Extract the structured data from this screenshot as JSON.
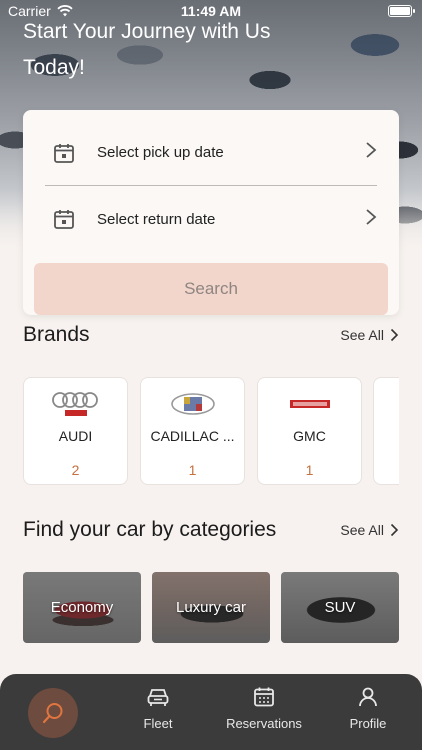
{
  "status_bar": {
    "carrier": "Carrier",
    "time": "11:49 AM"
  },
  "hero": {
    "title": "Start Your Journey with Us Today!"
  },
  "booking": {
    "pickup_label": "Select pick up date",
    "return_label": "Select return date",
    "search_label": "Search"
  },
  "brands": {
    "title": "Brands",
    "see_all": "See All",
    "items": [
      {
        "name": "AUDI",
        "count": "2",
        "logo": "audi-logo"
      },
      {
        "name": "CADILLAC ...",
        "count": "1",
        "logo": "cadillac-logo"
      },
      {
        "name": "GMC",
        "count": "1",
        "logo": "gmc-logo"
      }
    ]
  },
  "categories": {
    "title": "Find your car by categories",
    "see_all": "See All",
    "items": [
      {
        "label": "Economy"
      },
      {
        "label": "Luxury car"
      },
      {
        "label": "SUV"
      }
    ]
  },
  "tabbar": {
    "items": [
      {
        "label": "",
        "icon": "search-icon"
      },
      {
        "label": "Fleet",
        "icon": "car-icon"
      },
      {
        "label": "Reservations",
        "icon": "calendar-icon"
      },
      {
        "label": "Profile",
        "icon": "user-icon"
      }
    ]
  },
  "colors": {
    "accent": "#c4703f",
    "search_button_bg": "#f2d6cb",
    "tabbar_bg": "#3b3b3b",
    "active_tab_circle": "#6d4b3e"
  }
}
